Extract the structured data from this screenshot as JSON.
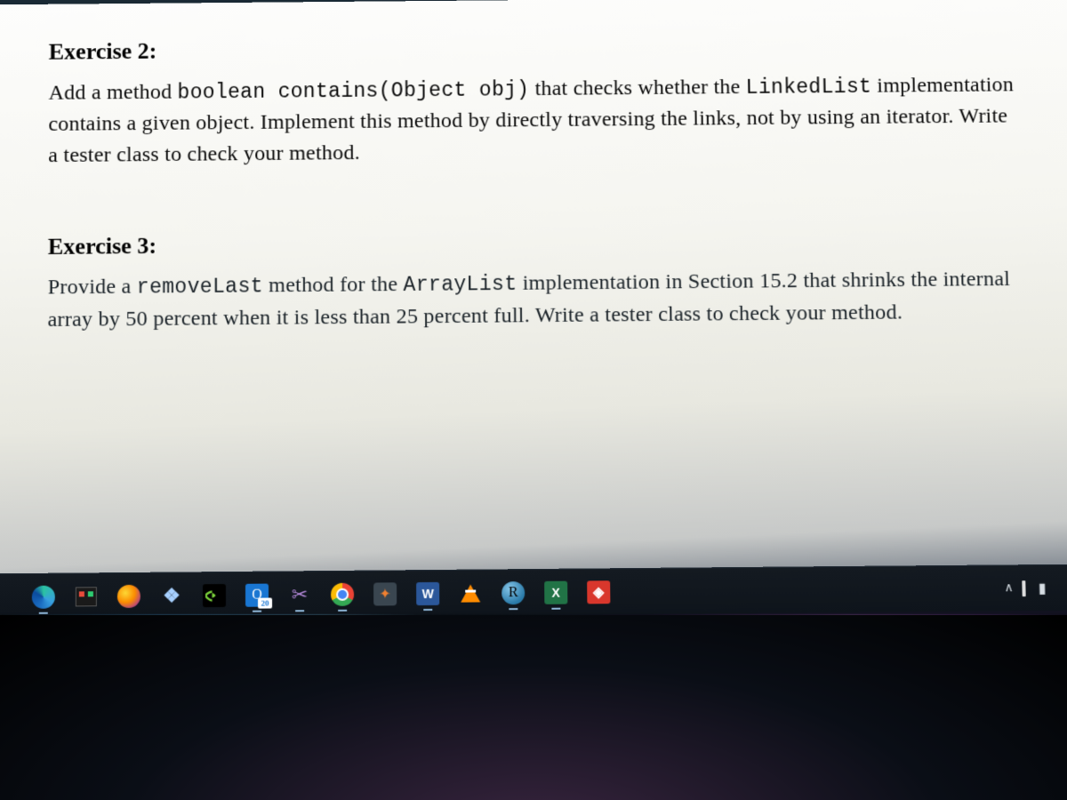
{
  "exercise2": {
    "heading": "Exercise 2:",
    "text_pre": "Add a method ",
    "code1": "boolean contains(Object obj)",
    "text_mid1": " that checks whether the ",
    "code2": "LinkedList",
    "text_rest": " implementation contains a given object. Implement this method by directly traversing the links, not by using an iterator. Write a tester class to check your method."
  },
  "exercise3": {
    "heading": "Exercise 3:",
    "text_pre": "Provide a ",
    "code1": "removeLast",
    "text_mid1": " method for the ",
    "code2": "ArrayList",
    "text_rest": " implementation in Section 15.2 that shrinks the internal array by 50 percent when it is less than 25 percent full. Write a tester class to check your method."
  },
  "taskbar": {
    "edge": "Microsoft Edge",
    "store": "Microsoft Store",
    "firefox": "Firefox",
    "dropbox": "Dropbox",
    "nvidia": "NVIDIA",
    "outlook_label": "O",
    "outlook_badge": "20",
    "snip": "Snipping Tool",
    "chrome": "Google Chrome",
    "vmware_label": "✦",
    "word_label": "W",
    "vlc": "VLC",
    "rstudio_label": "R",
    "excel_label": "X",
    "anydesk_label": "◈",
    "tray_caret": "∧"
  }
}
